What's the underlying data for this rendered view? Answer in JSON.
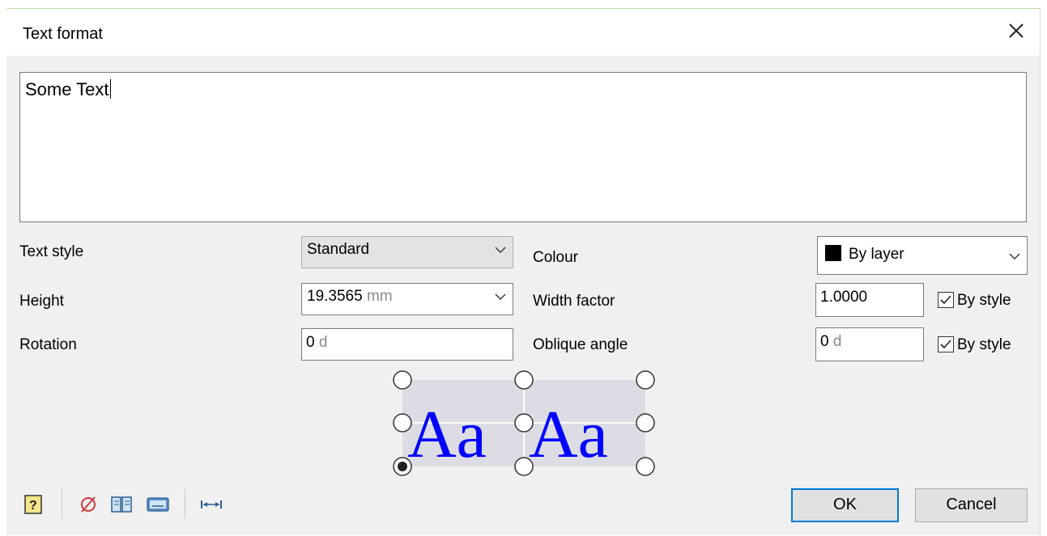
{
  "dialog": {
    "title": "Text format"
  },
  "text_input": {
    "value": "Some Text"
  },
  "fields": {
    "text_style": {
      "label": "Text style",
      "value": "Standard"
    },
    "height": {
      "label": "Height",
      "value": "19.3565",
      "unit": "mm"
    },
    "rotation": {
      "label": "Rotation",
      "value": "0",
      "unit": "d"
    },
    "colour": {
      "label": "Colour",
      "value": "By layer",
      "swatch_color": "#000000"
    },
    "width_factor": {
      "label": "Width factor",
      "value": "1.0000",
      "by_style_label": "By style",
      "by_style_checked": true
    },
    "oblique_angle": {
      "label": "Oblique angle",
      "value": "0",
      "unit": "d",
      "by_style_label": "By style",
      "by_style_checked": true
    }
  },
  "preview": {
    "sample_left": "Aa",
    "sample_right": "Aa",
    "text_color": "#0000ff",
    "selected_handle": "bottom-left"
  },
  "toolbar": {
    "icons": [
      "help-icon",
      "clear-icon",
      "book-icon",
      "keyboard-icon",
      "fit-width-icon"
    ]
  },
  "buttons": {
    "ok": "OK",
    "cancel": "Cancel"
  },
  "colors": {
    "accent": "#0078d7",
    "dialog_bg": "#f0f0f0"
  }
}
